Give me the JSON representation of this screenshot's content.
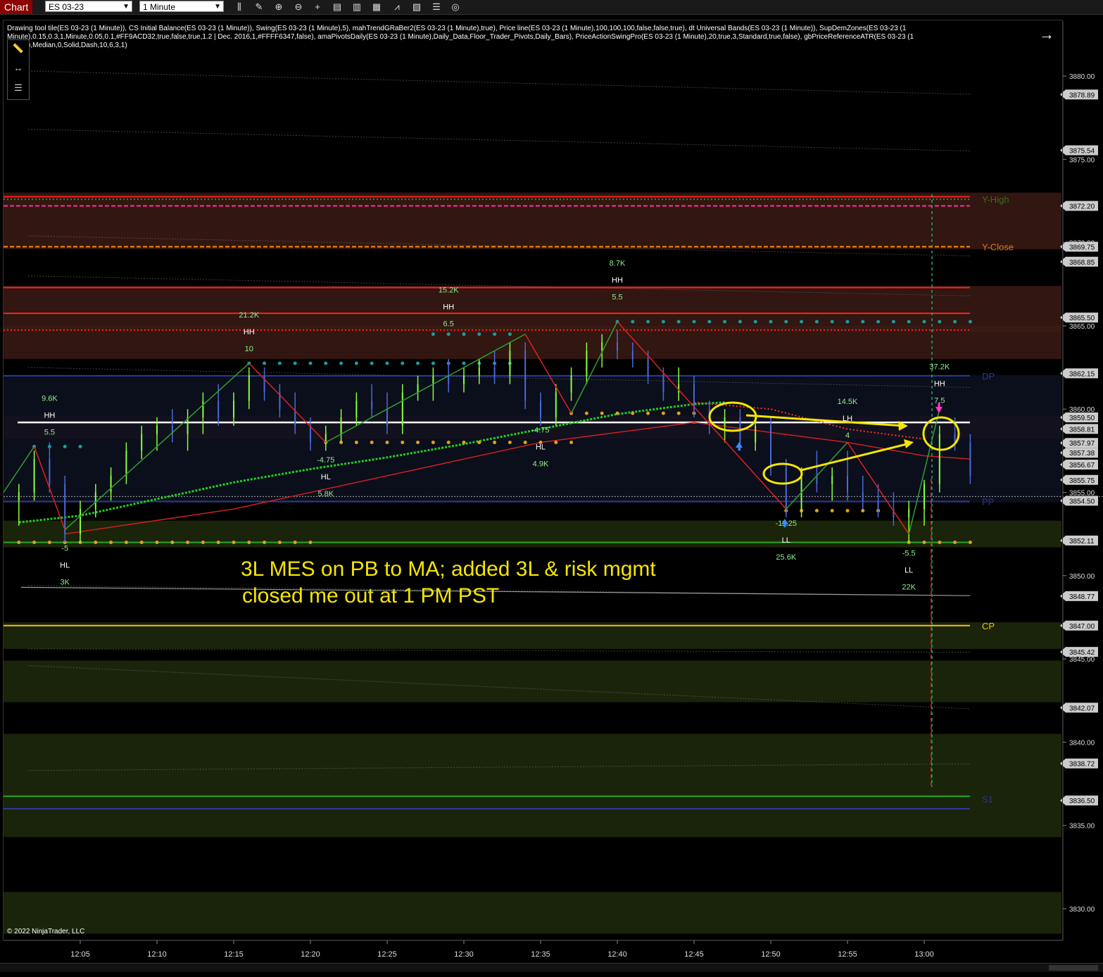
{
  "toolbar": {
    "tab_label": "Chart",
    "instrument": "ES 03-23",
    "interval": "1 Minute",
    "icons": [
      "bar-type-icon",
      "pencil-icon",
      "zoom-in-icon",
      "zoom-out-icon",
      "crosshair-icon",
      "data-box-icon",
      "properties-icon",
      "strategies-icon",
      "indicators-icon",
      "chart-trader-icon",
      "list-icon",
      "snapshot-icon"
    ]
  },
  "indicator_line": "Drawing tool tile(ES 03-23 (1 Minute)), CS Initial Balance(ES 03-23 (1 Minute)), Swing(ES 03-23 (1 Minute),5), mahTrendGRaBer2(ES 03-23 (1 Minute),true), Price line(ES 03-23 (1 Minute),100,100,100,false,false,true), dt Universal Bands(ES 03-23 (1 Minute)), SupDemZones(ES 03-23 (1 Minute),0.15,0.3,1,Minute,0.05,0.1,#FF9ACD32,true,false,true,1.2 | Dec. 2016,1,#FFFF6347,false), amaPivotsDaily(ES 03-23 (1 Minute),Daily_Data,Floor_Trader_Pivots,Daily_Bars), PriceActionSwingPro(ES 03-23 (1 Minute),20,true,3,Standard,true,false), gbPriceReferenceATR(ES 03-23 (1 Minute),Median,0,Solid,Dash,10,6,3,1)",
  "annotation": {
    "line1": "3L MES on PB to MA; added 3L & risk mgmt",
    "line2": "closed me out at 1 PM PST",
    "color": "#f5e600"
  },
  "copyright": "© 2022 NinjaTrader, LLC",
  "colors": {
    "background": "#000000",
    "resistance_zone": "#3a1a14",
    "support_zone": "#1e2a0c",
    "value_area": "#0d1020",
    "swing_up": "#2ea02e",
    "swing_down": "#e02020",
    "ma_green": "#22cc22",
    "price_line": "#ffffff",
    "pivot_dot_teal": "#1a9e9e",
    "pivot_dot_orange": "#e0a020",
    "label_green": "#90ee90",
    "highlight_yellow": "#f5e600"
  },
  "level_labels": [
    {
      "text": "Y-High",
      "price": 3872.6,
      "color": "#3d6e1a"
    },
    {
      "text": "Y-Close",
      "price": 3869.75,
      "color": "#e07a1a"
    },
    {
      "text": "DP",
      "price": 3862.0,
      "color": "#2a3a8a"
    },
    {
      "text": "PP",
      "price": 3854.45,
      "color": "#2a3a8a"
    },
    {
      "text": "CP",
      "price": 3847.0,
      "color": "#f5c400"
    },
    {
      "text": "S1",
      "price": 3836.6,
      "color": "#2a3a8a"
    }
  ],
  "swing_labels": [
    {
      "lines": [
        "9.6K",
        "HH",
        "5.5"
      ],
      "time": "12:03",
      "price": 3860.5
    },
    {
      "lines": [
        "21.2K",
        "HH",
        "10"
      ],
      "time": "12:16",
      "price": 3865.5
    },
    {
      "lines": [
        "15.2K",
        "HH",
        "6.5"
      ],
      "time": "12:29",
      "price": 3867.0
    },
    {
      "lines": [
        "8.7K",
        "HH",
        "5.5"
      ],
      "time": "12:40",
      "price": 3868.6
    },
    {
      "lines": [
        "-4.75",
        "HL",
        "5.8K"
      ],
      "time": "12:21",
      "price": 3856.8
    },
    {
      "lines": [
        "-4.75",
        "HL",
        "4.9K"
      ],
      "time": "12:35",
      "price": 3858.6
    },
    {
      "lines": [
        "-5",
        "HL",
        "3K"
      ],
      "time": "12:04",
      "price": 3851.5
    },
    {
      "lines": [
        "-11.25",
        "LL",
        "25.6K"
      ],
      "time": "12:51",
      "price": 3853.0
    },
    {
      "lines": [
        "-5.5",
        "LL",
        "22K"
      ],
      "time": "12:59",
      "price": 3851.2
    },
    {
      "lines": [
        "14.5K",
        "LH",
        "4"
      ],
      "time": "12:55",
      "price": 3860.3
    },
    {
      "lines": [
        "37.2K",
        "HH",
        "7.5"
      ],
      "time": "13:01",
      "price": 3862.4
    }
  ],
  "chart_data": {
    "type": "candlestick",
    "instrument": "ES 03-23",
    "interval": "1 Minute",
    "price_axis_ticks": [
      3880.0,
      3875.0,
      3870.0,
      3865.0,
      3860.0,
      3855.0,
      3850.0,
      3845.0,
      3840.0,
      3835.0,
      3830.0
    ],
    "price_axis_markers": [
      {
        "value": "3878.89",
        "color": "#cccccc"
      },
      {
        "value": "3875.54",
        "color": "#cccccc"
      },
      {
        "value": "3872.20",
        "color": "#cccccc"
      },
      {
        "value": "3869.75",
        "color": "#cccccc"
      },
      {
        "value": "3868.85",
        "color": "#cccccc"
      },
      {
        "value": "3865.50",
        "color": "#cccccc"
      },
      {
        "value": "3862.15",
        "color": "#cccccc"
      },
      {
        "value": "3859.50",
        "color": "#cccccc"
      },
      {
        "value": "3858.81",
        "color": "#cccccc"
      },
      {
        "value": "3857.97",
        "color": "#cccccc"
      },
      {
        "value": "3857.38",
        "color": "#cccccc"
      },
      {
        "value": "3856.67",
        "color": "#cccccc"
      },
      {
        "value": "3855.75",
        "color": "#cccccc"
      },
      {
        "value": "3854.50",
        "color": "#cccccc"
      },
      {
        "value": "3852.11",
        "color": "#cccccc"
      },
      {
        "value": "3848.77",
        "color": "#cccccc"
      },
      {
        "value": "3847.00",
        "color": "#cccccc"
      },
      {
        "value": "3845.42",
        "color": "#cccccc"
      },
      {
        "value": "3842.07",
        "color": "#cccccc"
      },
      {
        "value": "3838.72",
        "color": "#cccccc"
      },
      {
        "value": "3836.50",
        "color": "#cccccc"
      }
    ],
    "time_axis_ticks": [
      "12:05",
      "12:10",
      "12:15",
      "12:20",
      "12:25",
      "12:30",
      "12:35",
      "12:40",
      "12:45",
      "12:50",
      "12:55",
      "13:00"
    ],
    "y_range": [
      3828.0,
      3883.5
    ],
    "x_range": [
      "12:00",
      "13:09"
    ],
    "horizontal_levels": [
      {
        "price": 3872.75,
        "color": "#ff2020",
        "style": "solid"
      },
      {
        "price": 3872.6,
        "color": "#3d8a1a",
        "style": "dotted"
      },
      {
        "price": 3872.2,
        "color": "#ff3399",
        "style": "dashed"
      },
      {
        "price": 3869.75,
        "color": "#ff8c00",
        "style": "dashed"
      },
      {
        "price": 3867.3,
        "color": "#ff2020",
        "style": "solid"
      },
      {
        "price": 3865.75,
        "color": "#ff2020",
        "style": "solid"
      },
      {
        "price": 3864.75,
        "color": "#ff2020",
        "style": "dotted"
      },
      {
        "price": 3862.0,
        "color": "#2a3a9a",
        "style": "solid"
      },
      {
        "price": 3854.45,
        "color": "#2a3a9a",
        "style": "solid"
      },
      {
        "price": 3852.0,
        "color": "#22aa22",
        "style": "solid"
      },
      {
        "price": 3847.0,
        "color": "#f5c400",
        "style": "solid"
      },
      {
        "price": 3836.75,
        "color": "#22aa22",
        "style": "solid"
      },
      {
        "price": 3836.0,
        "color": "#2a3a9a",
        "style": "solid"
      }
    ],
    "candles": [
      {
        "t": "12:01",
        "o": 3854.5,
        "h": 3855.5,
        "l": 3853.0,
        "c": 3855.0
      },
      {
        "t": "12:02",
        "o": 3855.0,
        "h": 3857.5,
        "l": 3854.5,
        "c": 3857.0
      },
      {
        "t": "12:03",
        "o": 3857.0,
        "h": 3858.0,
        "l": 3855.0,
        "c": 3855.5
      },
      {
        "t": "12:04",
        "o": 3855.5,
        "h": 3856.0,
        "l": 3852.0,
        "c": 3852.5
      },
      {
        "t": "12:05",
        "o": 3852.5,
        "h": 3854.5,
        "l": 3852.0,
        "c": 3854.0
      },
      {
        "t": "12:06",
        "o": 3854.0,
        "h": 3855.5,
        "l": 3853.5,
        "c": 3855.0
      },
      {
        "t": "12:07",
        "o": 3855.0,
        "h": 3856.5,
        "l": 3854.5,
        "c": 3856.0
      },
      {
        "t": "12:08",
        "o": 3856.0,
        "h": 3858.0,
        "l": 3855.5,
        "c": 3857.5
      },
      {
        "t": "12:09",
        "o": 3857.5,
        "h": 3859.0,
        "l": 3857.0,
        "c": 3858.5
      },
      {
        "t": "12:10",
        "o": 3858.5,
        "h": 3859.5,
        "l": 3857.5,
        "c": 3859.0
      },
      {
        "t": "12:11",
        "o": 3859.0,
        "h": 3860.0,
        "l": 3858.0,
        "c": 3858.5
      },
      {
        "t": "12:12",
        "o": 3858.5,
        "h": 3860.0,
        "l": 3857.5,
        "c": 3859.5
      },
      {
        "t": "12:13",
        "o": 3859.5,
        "h": 3861.0,
        "l": 3858.5,
        "c": 3860.5
      },
      {
        "t": "12:14",
        "o": 3860.5,
        "h": 3861.5,
        "l": 3859.0,
        "c": 3859.5
      },
      {
        "t": "12:15",
        "o": 3859.5,
        "h": 3861.0,
        "l": 3859.0,
        "c": 3860.5
      },
      {
        "t": "12:16",
        "o": 3860.5,
        "h": 3862.5,
        "l": 3860.0,
        "c": 3862.0
      },
      {
        "t": "12:17",
        "o": 3862.0,
        "h": 3862.5,
        "l": 3860.5,
        "c": 3861.0
      },
      {
        "t": "12:18",
        "o": 3861.0,
        "h": 3861.5,
        "l": 3859.5,
        "c": 3860.0
      },
      {
        "t": "12:19",
        "o": 3860.0,
        "h": 3861.0,
        "l": 3858.5,
        "c": 3859.0
      },
      {
        "t": "12:20",
        "o": 3859.0,
        "h": 3859.5,
        "l": 3857.5,
        "c": 3858.0
      },
      {
        "t": "12:21",
        "o": 3858.0,
        "h": 3859.0,
        "l": 3857.5,
        "c": 3858.5
      },
      {
        "t": "12:22",
        "o": 3858.5,
        "h": 3860.0,
        "l": 3858.0,
        "c": 3859.5
      },
      {
        "t": "12:23",
        "o": 3859.5,
        "h": 3861.0,
        "l": 3859.0,
        "c": 3860.5
      },
      {
        "t": "12:24",
        "o": 3860.5,
        "h": 3861.5,
        "l": 3859.5,
        "c": 3860.0
      },
      {
        "t": "12:25",
        "o": 3860.0,
        "h": 3861.0,
        "l": 3858.5,
        "c": 3859.0
      },
      {
        "t": "12:26",
        "o": 3859.0,
        "h": 3861.5,
        "l": 3858.5,
        "c": 3861.0
      },
      {
        "t": "12:27",
        "o": 3861.0,
        "h": 3862.0,
        "l": 3860.5,
        "c": 3861.5
      },
      {
        "t": "12:28",
        "o": 3861.5,
        "h": 3862.5,
        "l": 3860.5,
        "c": 3862.0
      },
      {
        "t": "12:29",
        "o": 3862.0,
        "h": 3863.0,
        "l": 3861.0,
        "c": 3861.5
      },
      {
        "t": "12:30",
        "o": 3861.5,
        "h": 3862.5,
        "l": 3861.0,
        "c": 3862.0
      },
      {
        "t": "12:31",
        "o": 3862.0,
        "h": 3863.0,
        "l": 3861.5,
        "c": 3862.5
      },
      {
        "t": "12:32",
        "o": 3862.5,
        "h": 3863.5,
        "l": 3861.5,
        "c": 3862.0
      },
      {
        "t": "12:33",
        "o": 3862.0,
        "h": 3864.0,
        "l": 3861.5,
        "c": 3863.5
      },
      {
        "t": "12:34",
        "o": 3863.5,
        "h": 3864.0,
        "l": 3860.0,
        "c": 3860.5
      },
      {
        "t": "12:35",
        "o": 3860.5,
        "h": 3861.0,
        "l": 3859.0,
        "c": 3859.5
      },
      {
        "t": "12:36",
        "o": 3859.5,
        "h": 3861.5,
        "l": 3859.0,
        "c": 3861.0
      },
      {
        "t": "12:37",
        "o": 3861.0,
        "h": 3862.5,
        "l": 3860.5,
        "c": 3862.0
      },
      {
        "t": "12:38",
        "o": 3862.0,
        "h": 3864.0,
        "l": 3861.5,
        "c": 3863.5
      },
      {
        "t": "12:39",
        "o": 3863.5,
        "h": 3864.5,
        "l": 3862.5,
        "c": 3864.0
      },
      {
        "t": "12:40",
        "o": 3864.0,
        "h": 3864.75,
        "l": 3863.0,
        "c": 3863.5
      },
      {
        "t": "12:41",
        "o": 3863.5,
        "h": 3864.0,
        "l": 3862.5,
        "c": 3863.0
      },
      {
        "t": "12:42",
        "o": 3863.0,
        "h": 3863.5,
        "l": 3861.5,
        "c": 3862.0
      },
      {
        "t": "12:43",
        "o": 3862.0,
        "h": 3862.5,
        "l": 3860.5,
        "c": 3861.0
      },
      {
        "t": "12:44",
        "o": 3861.0,
        "h": 3862.5,
        "l": 3860.5,
        "c": 3861.5
      },
      {
        "t": "12:45",
        "o": 3861.5,
        "h": 3862.0,
        "l": 3859.5,
        "c": 3860.0
      },
      {
        "t": "12:46",
        "o": 3860.0,
        "h": 3860.5,
        "l": 3858.5,
        "c": 3859.0
      },
      {
        "t": "12:47",
        "o": 3859.0,
        "h": 3860.0,
        "l": 3858.0,
        "c": 3859.5
      },
      {
        "t": "12:48",
        "o": 3859.5,
        "h": 3860.0,
        "l": 3857.5,
        "c": 3858.0
      },
      {
        "t": "12:49",
        "o": 3858.0,
        "h": 3859.5,
        "l": 3857.5,
        "c": 3859.0
      },
      {
        "t": "12:50",
        "o": 3859.0,
        "h": 3859.5,
        "l": 3856.0,
        "c": 3856.5
      },
      {
        "t": "12:51",
        "o": 3856.5,
        "h": 3857.0,
        "l": 3853.5,
        "c": 3854.0
      },
      {
        "t": "12:52",
        "o": 3854.0,
        "h": 3856.5,
        "l": 3853.5,
        "c": 3856.0
      },
      {
        "t": "12:53",
        "o": 3856.0,
        "h": 3857.5,
        "l": 3855.0,
        "c": 3855.5
      },
      {
        "t": "12:54",
        "o": 3855.5,
        "h": 3856.5,
        "l": 3854.5,
        "c": 3856.0
      },
      {
        "t": "12:55",
        "o": 3856.0,
        "h": 3857.5,
        "l": 3854.5,
        "c": 3855.0
      },
      {
        "t": "12:56",
        "o": 3855.0,
        "h": 3856.0,
        "l": 3854.0,
        "c": 3854.5
      },
      {
        "t": "12:57",
        "o": 3854.5,
        "h": 3855.5,
        "l": 3853.5,
        "c": 3854.0
      },
      {
        "t": "12:58",
        "o": 3854.0,
        "h": 3855.0,
        "l": 3853.0,
        "c": 3853.5
      },
      {
        "t": "12:59",
        "o": 3853.5,
        "h": 3854.5,
        "l": 3852.0,
        "c": 3854.0
      },
      {
        "t": "13:00",
        "o": 3854.0,
        "h": 3855.75,
        "l": 3853.0,
        "c": 3855.5
      },
      {
        "t": "13:01",
        "o": 3855.5,
        "h": 3859.0,
        "l": 3855.0,
        "c": 3858.5
      },
      {
        "t": "13:02",
        "o": 3858.5,
        "h": 3859.5,
        "l": 3857.5,
        "c": 3858.0
      },
      {
        "t": "13:03",
        "o": 3858.0,
        "h": 3858.5,
        "l": 3855.5,
        "c": 3856.0
      }
    ],
    "swing_path": [
      {
        "t": "12:00",
        "p": 3855.0
      },
      {
        "t": "12:02",
        "p": 3857.75
      },
      {
        "t": "12:04",
        "p": 3852.75
      },
      {
        "t": "12:16",
        "p": 3862.75
      },
      {
        "t": "12:21",
        "p": 3858.0
      },
      {
        "t": "12:34",
        "p": 3864.5
      },
      {
        "t": "12:37",
        "p": 3859.75
      },
      {
        "t": "12:40",
        "p": 3865.25
      },
      {
        "t": "12:51",
        "p": 3854.0
      },
      {
        "t": "12:55",
        "p": 3858.0
      },
      {
        "t": "12:59",
        "p": 3852.5
      },
      {
        "t": "13:01",
        "p": 3860.0
      }
    ],
    "moving_average": [
      {
        "t": "12:01",
        "p": 3853.2
      },
      {
        "t": "12:05",
        "p": 3853.6
      },
      {
        "t": "12:10",
        "p": 3854.6
      },
      {
        "t": "12:15",
        "p": 3855.6
      },
      {
        "t": "12:20",
        "p": 3856.4
      },
      {
        "t": "12:25",
        "p": 3857.1
      },
      {
        "t": "12:30",
        "p": 3857.9
      },
      {
        "t": "12:35",
        "p": 3858.8
      },
      {
        "t": "12:40",
        "p": 3859.7
      },
      {
        "t": "12:45",
        "p": 3860.3
      },
      {
        "t": "12:47",
        "p": 3860.4
      }
    ],
    "price_line": 3859.2
  }
}
